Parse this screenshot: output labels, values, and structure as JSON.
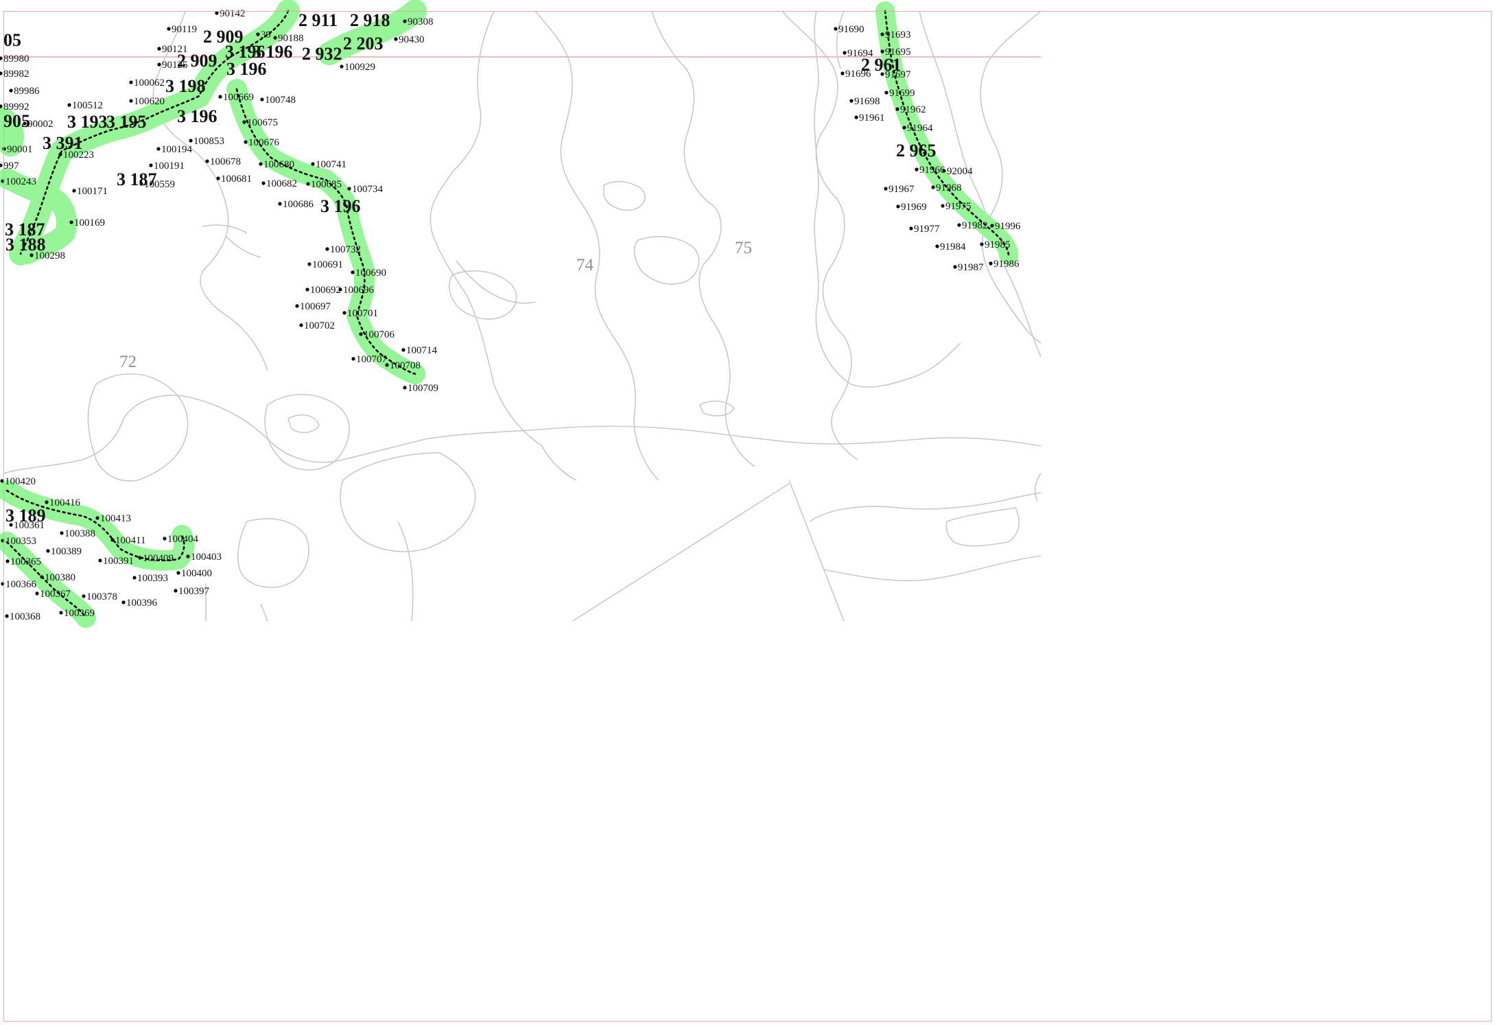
{
  "map": {
    "zones": [
      "72",
      "74",
      "75"
    ],
    "colors": {
      "route": "#96f596",
      "node": "#000000",
      "boundary": "#c9c9c9",
      "frame": "#e8a6a6",
      "zone_label": "#8f8f8f"
    },
    "route_labels": [
      "2 911",
      "2 918",
      "2 909",
      "3 196",
      "3 196",
      "2 909",
      "3 196",
      "2 932",
      "2 203",
      "3 198",
      "3 193",
      "3 195",
      "3 196",
      "3 391",
      "3 187",
      "3 196",
      "3 187",
      "3 188",
      "905",
      "05",
      "2 961",
      "2 965",
      "3 189"
    ],
    "point_labels": [
      "90119",
      "90121",
      "90125",
      "90142",
      "90430",
      "90308",
      "90188",
      "100929",
      "39",
      "100062",
      "100620",
      "100512",
      "100669",
      "100748",
      "100675",
      "100676",
      "100853",
      "100678",
      "100680",
      "100741",
      "100681",
      "100682",
      "100685",
      "100734",
      "100686",
      "100732",
      "100691",
      "100690",
      "100692",
      "100696",
      "100697",
      "100701",
      "100702",
      "100706",
      "100714",
      "100707",
      "100708",
      "100709",
      "100194",
      "100191",
      "100559",
      "100243",
      "100223",
      "100171",
      "100169",
      "100298",
      "90001",
      "90002",
      "89992",
      "89986",
      "89982",
      "89980",
      "997",
      "91690",
      "91693",
      "91694",
      "91695",
      "91696",
      "91697",
      "91698",
      "91699",
      "91961",
      "91962",
      "91964",
      "91966",
      "92004",
      "91967",
      "91968",
      "91969",
      "91975",
      "91977",
      "91982",
      "91996",
      "91984",
      "91985",
      "91987",
      "91986",
      "100420",
      "100416",
      "100413",
      "100388",
      "100411",
      "100404",
      "100389",
      "100409",
      "100403",
      "100391",
      "100365",
      "100393",
      "100400",
      "100366",
      "100380",
      "100367",
      "100397",
      "100378",
      "100396",
      "100368",
      "100369",
      "100353",
      "100361"
    ]
  }
}
